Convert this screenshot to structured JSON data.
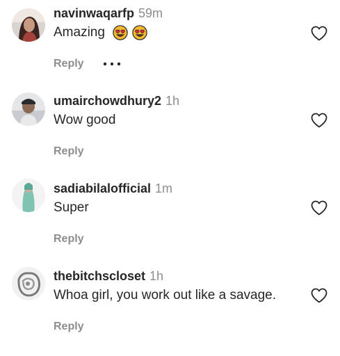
{
  "comments": [
    {
      "username": "navinwaqarfp",
      "time": "59m",
      "text": "Amazing",
      "emojis": [
        "heart-eyes-emoji",
        "heart-eyes-emoji"
      ],
      "reply_label": "Reply",
      "more_icon": "more-options-icon",
      "like_icon": "heart-outline-icon"
    },
    {
      "username": "umairchowdhury2",
      "time": "1h",
      "text": "Wow good",
      "reply_label": "Reply",
      "like_icon": "heart-outline-icon"
    },
    {
      "username": "sadiabilalofficial",
      "time": "1m",
      "text": "Super",
      "reply_label": "Reply",
      "like_icon": "heart-outline-icon"
    },
    {
      "username": "thebitchscloset",
      "time": "1h",
      "text": "Whoa girl, you work out like a savage.",
      "reply_label": "Reply",
      "like_icon": "heart-outline-icon"
    }
  ],
  "colors": {
    "text": "#262626",
    "muted": "#8e8e8e",
    "background": "#ffffff",
    "emoji_face": "#f5b82e",
    "emoji_heart": "#e8253a"
  }
}
